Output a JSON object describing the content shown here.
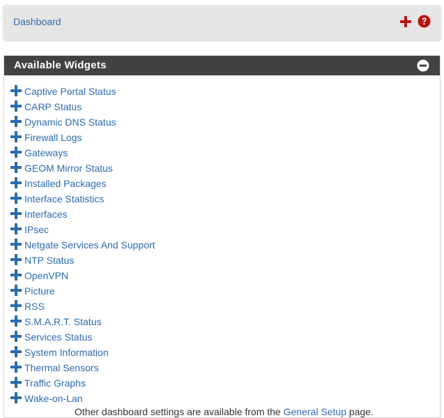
{
  "breadcrumb": {
    "label": "Dashboard"
  },
  "toolbar": {
    "add_icon": "plus-icon",
    "help_icon": "question-circle-icon",
    "accent": "#b8150c"
  },
  "panel": {
    "title": "Available Widgets",
    "collapse_icon": "minus-circle-icon",
    "widgets": [
      "Captive Portal Status",
      "CARP Status",
      "Dynamic DNS Status",
      "Firewall Logs",
      "Gateways",
      "GEOM Mirror Status",
      "Installed Packages",
      "Interface Statistics",
      "Interfaces",
      "IPsec",
      "Netgate Services And Support",
      "NTP Status",
      "OpenVPN",
      "Picture",
      "RSS",
      "S.M.A.R.T. Status",
      "Services Status",
      "System Information",
      "Thermal Sensors",
      "Traffic Graphs",
      "Wake-on-Lan"
    ],
    "footer": {
      "prefix": "Other dashboard settings are available from the ",
      "link": "General Setup",
      "suffix": " page."
    }
  },
  "colors": {
    "link": "#2b6cad",
    "header_bg": "#424242",
    "breadcrumb_bg": "#e6e6e6"
  }
}
